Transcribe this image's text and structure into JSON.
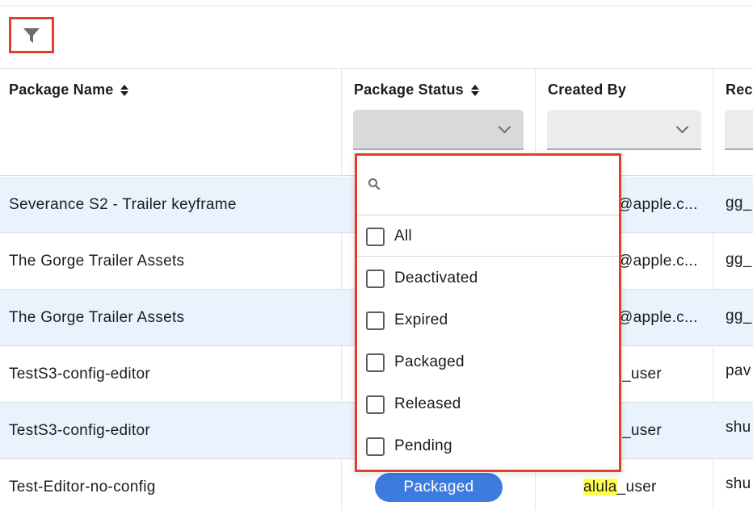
{
  "toolbar": {
    "filter_icon": "filter-funnel-icon"
  },
  "columns": [
    {
      "label": "Package Name",
      "sortable": true
    },
    {
      "label": "Package Status",
      "sortable": true
    },
    {
      "label": "Created By",
      "sortable": false
    },
    {
      "label": "Rec",
      "sortable": false
    }
  ],
  "rows": [
    {
      "name": "Severance S2 - Trailer keyframe",
      "created_by": "@apple.c...",
      "rec": "gg_"
    },
    {
      "name": "The Gorge Trailer Assets",
      "created_by": "@apple.c...",
      "rec": "gg_"
    },
    {
      "name": "The Gorge Trailer Assets",
      "created_by": "@apple.c...",
      "rec": "gg_"
    },
    {
      "name": "TestS3-config-editor",
      "created_by": "_user",
      "rec": "pav"
    },
    {
      "name": "TestS3-config-editor",
      "created_by": "_user",
      "rec": "shu"
    },
    {
      "name": "Test-Editor-no-config",
      "status": "Packaged",
      "created_by_highlight": "alula",
      "created_by_rest": "_user",
      "rec": "shu"
    }
  ],
  "status_dropdown": {
    "search_placeholder": "",
    "all_label": "All",
    "options": [
      "Deactivated",
      "Expired",
      "Packaged",
      "Released",
      "Pending"
    ]
  },
  "colors": {
    "accent": "#3d7be0",
    "highlight_border": "#e0402a",
    "row_alt": "#eaf3fd",
    "search_highlight": "#ffff4d"
  }
}
